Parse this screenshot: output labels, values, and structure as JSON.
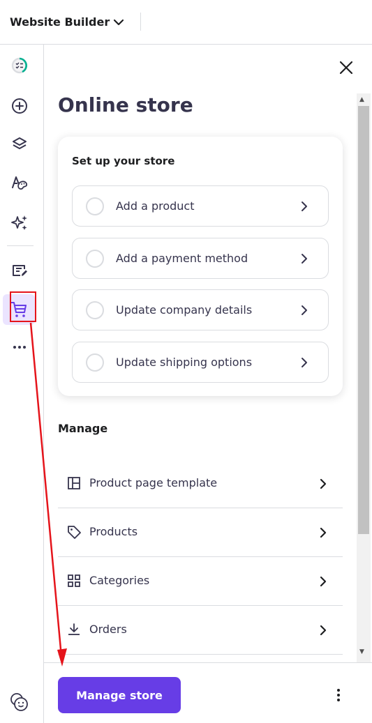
{
  "header": {
    "title": "Website Builder",
    "dropdown_icon": "chevron-down-icon"
  },
  "sidebar": {
    "items": [
      {
        "name": "progress-checklist",
        "icon": "checklist-progress-icon"
      },
      {
        "name": "add-element",
        "icon": "plus-circle-icon"
      },
      {
        "name": "layers",
        "icon": "layers-icon"
      },
      {
        "name": "styles",
        "icon": "palette-icon"
      },
      {
        "name": "ai-tools",
        "icon": "sparkles-icon"
      },
      {
        "name": "blog",
        "icon": "edit-page-icon"
      },
      {
        "name": "online-store",
        "icon": "cart-icon",
        "active": true
      },
      {
        "name": "more",
        "icon": "more-horizontal-icon"
      }
    ],
    "help_icon": "help-face-icon"
  },
  "panel": {
    "title": "Online store",
    "close_icon": "close-icon",
    "setup": {
      "title": "Set up your store",
      "tasks": [
        {
          "label": "Add a product",
          "completed": false
        },
        {
          "label": "Add a payment method",
          "completed": false
        },
        {
          "label": "Update company details",
          "completed": false
        },
        {
          "label": "Update shipping options",
          "completed": false
        }
      ]
    },
    "manage": {
      "title": "Manage",
      "items": [
        {
          "label": "Product page template",
          "icon": "layout-template-icon"
        },
        {
          "label": "Products",
          "icon": "tag-icon"
        },
        {
          "label": "Categories",
          "icon": "grid-icon"
        },
        {
          "label": "Orders",
          "icon": "download-icon"
        }
      ]
    }
  },
  "footer": {
    "primary_label": "Manage store",
    "more_icon": "more-vertical-icon"
  },
  "colors": {
    "accent": "#673de6",
    "accent_light": "#ebe4ff",
    "text_dark": "#36344d",
    "border": "#dadce0",
    "annotation": "#e5141b"
  }
}
